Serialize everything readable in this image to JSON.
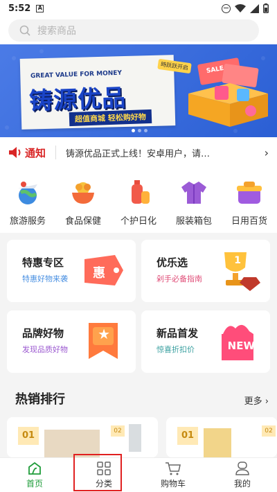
{
  "status_bar": {
    "time": "5:52",
    "notification_icon": "A"
  },
  "search": {
    "placeholder": "搜索商品"
  },
  "banner": {
    "tagline": "GREAT VALUE FOR MONEY",
    "title": "铸源优品",
    "subtitle": "超值商城  轻松购好物",
    "stamp": "時跃跃开启",
    "sale_label": "SALE"
  },
  "notice": {
    "label": "通知",
    "text": "铸源优品正式上线！安卓用户，请…"
  },
  "categories": [
    {
      "label": "旅游服务",
      "icon": "travel-icon"
    },
    {
      "label": "食品保健",
      "icon": "food-icon"
    },
    {
      "label": "个护日化",
      "icon": "personal-care-icon"
    },
    {
      "label": "服装箱包",
      "icon": "clothing-icon"
    },
    {
      "label": "日用百货",
      "icon": "daily-goods-icon"
    }
  ],
  "promos": [
    {
      "title": "特惠专区",
      "subtitle": "特惠好物来袭",
      "sub_color": "#4a90e2",
      "badge": "惠"
    },
    {
      "title": "优乐选",
      "subtitle": "剁手必备指南",
      "sub_color": "#e0507a",
      "badge": "1"
    },
    {
      "title": "品牌好物",
      "subtitle": "发现品质好物",
      "sub_color": "#9b59d0",
      "badge": "★"
    },
    {
      "title": "新品首发",
      "subtitle": "惊喜折扣价",
      "sub_color": "#3aa0a0",
      "badge": "NEW"
    }
  ],
  "hot": {
    "title": "热销排行",
    "more": "更多",
    "ranks": [
      "01",
      "02",
      "01",
      "02"
    ]
  },
  "tabbar": [
    {
      "label": "首页",
      "active": true
    },
    {
      "label": "分类",
      "active": false
    },
    {
      "label": "购物车",
      "active": false
    },
    {
      "label": "我的",
      "active": false
    }
  ],
  "colors": {
    "accent": "#1f9c3a",
    "notice_red": "#d92525",
    "highlight_box": "#e02020"
  }
}
